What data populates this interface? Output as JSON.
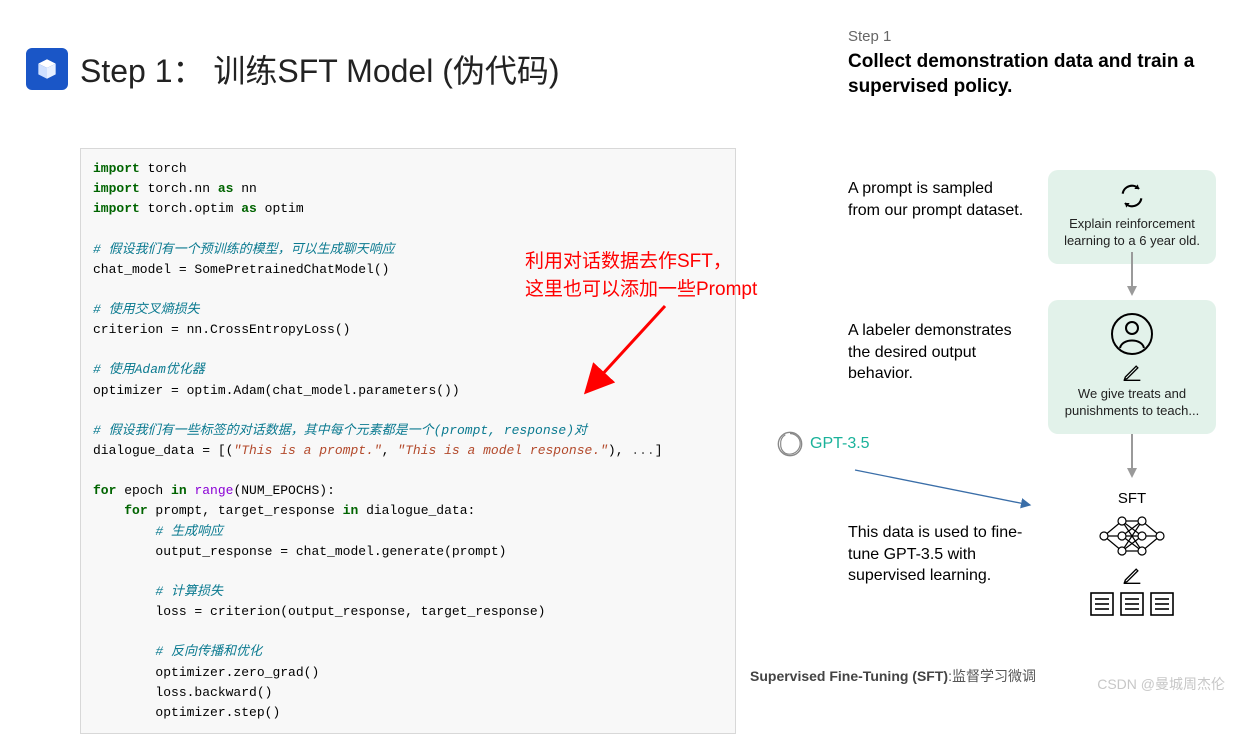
{
  "title": "Step 1： 训练SFT Model (伪代码)",
  "annotation": {
    "line1": "利用对话数据去作SFT，",
    "line2": "这里也可以添加一些Prompt"
  },
  "code": {
    "l1_kw1": "import",
    "l1_t": " torch",
    "l2_kw1": "import",
    "l2_t": " torch.nn ",
    "l2_kw2": "as",
    "l2_t2": " nn",
    "l3_kw1": "import",
    "l3_t": " torch.optim ",
    "l3_kw2": "as",
    "l3_t2": " optim",
    "c1": "# 假设我们有一个预训练的模型，可以生成聊天响应",
    "l5": "chat_model = SomePretrainedChatModel()",
    "c2": "# 使用交叉熵损失",
    "l7": "criterion = nn.CrossEntropyLoss()",
    "c3": "# 使用Adam优化器",
    "l9": "optimizer = optim.Adam(chat_model.parameters())",
    "c4": "# 假设我们有一些标签的对话数据，其中每个元素都是一个(prompt, response)对",
    "l11a": "dialogue_data = [(",
    "l11s1": "\"This is a prompt.\"",
    "l11b": ", ",
    "l11s2": "\"This is a model response.\"",
    "l11c": "), ",
    "l11d": "...",
    "l11e": "]",
    "l13_kw1": "for",
    "l13_t1": " epoch ",
    "l13_kw2": "in",
    "l13_t2": " ",
    "l13_bi": "range",
    "l13_t3": "(NUM_EPOCHS):",
    "l14_kw1": "for",
    "l14_t1": " prompt, target_response ",
    "l14_kw2": "in",
    "l14_t2": " dialogue_data:",
    "c5": "# 生成响应",
    "l16": "output_response = chat_model.generate(prompt)",
    "c6": "# 计算损失",
    "l18": "loss = criterion(output_response, target_response)",
    "c7": "# 反向传播和优化",
    "l20": "optimizer.zero_grad()",
    "l21": "loss.backward()",
    "l22": "optimizer.step()"
  },
  "right": {
    "step_label": "Step 1",
    "heading": "Collect demonstration data and train a supervised policy.",
    "block1": "A prompt is sampled from our prompt dataset.",
    "block2": "A labeler demonstrates the desired output behavior.",
    "block3": "This data is used to fine-tune GPT-3.5 with supervised learning.",
    "gpt_label": "GPT-3.5",
    "card1": "Explain reinforcement learning to a 6 year old.",
    "card2": "We give treats and punishments to teach...",
    "sft_label": "SFT"
  },
  "footer": {
    "bold": "Supervised Fine-Tuning (SFT)",
    "rest": ":监督学习微调"
  },
  "watermark": "CSDN @曼城周杰伦"
}
